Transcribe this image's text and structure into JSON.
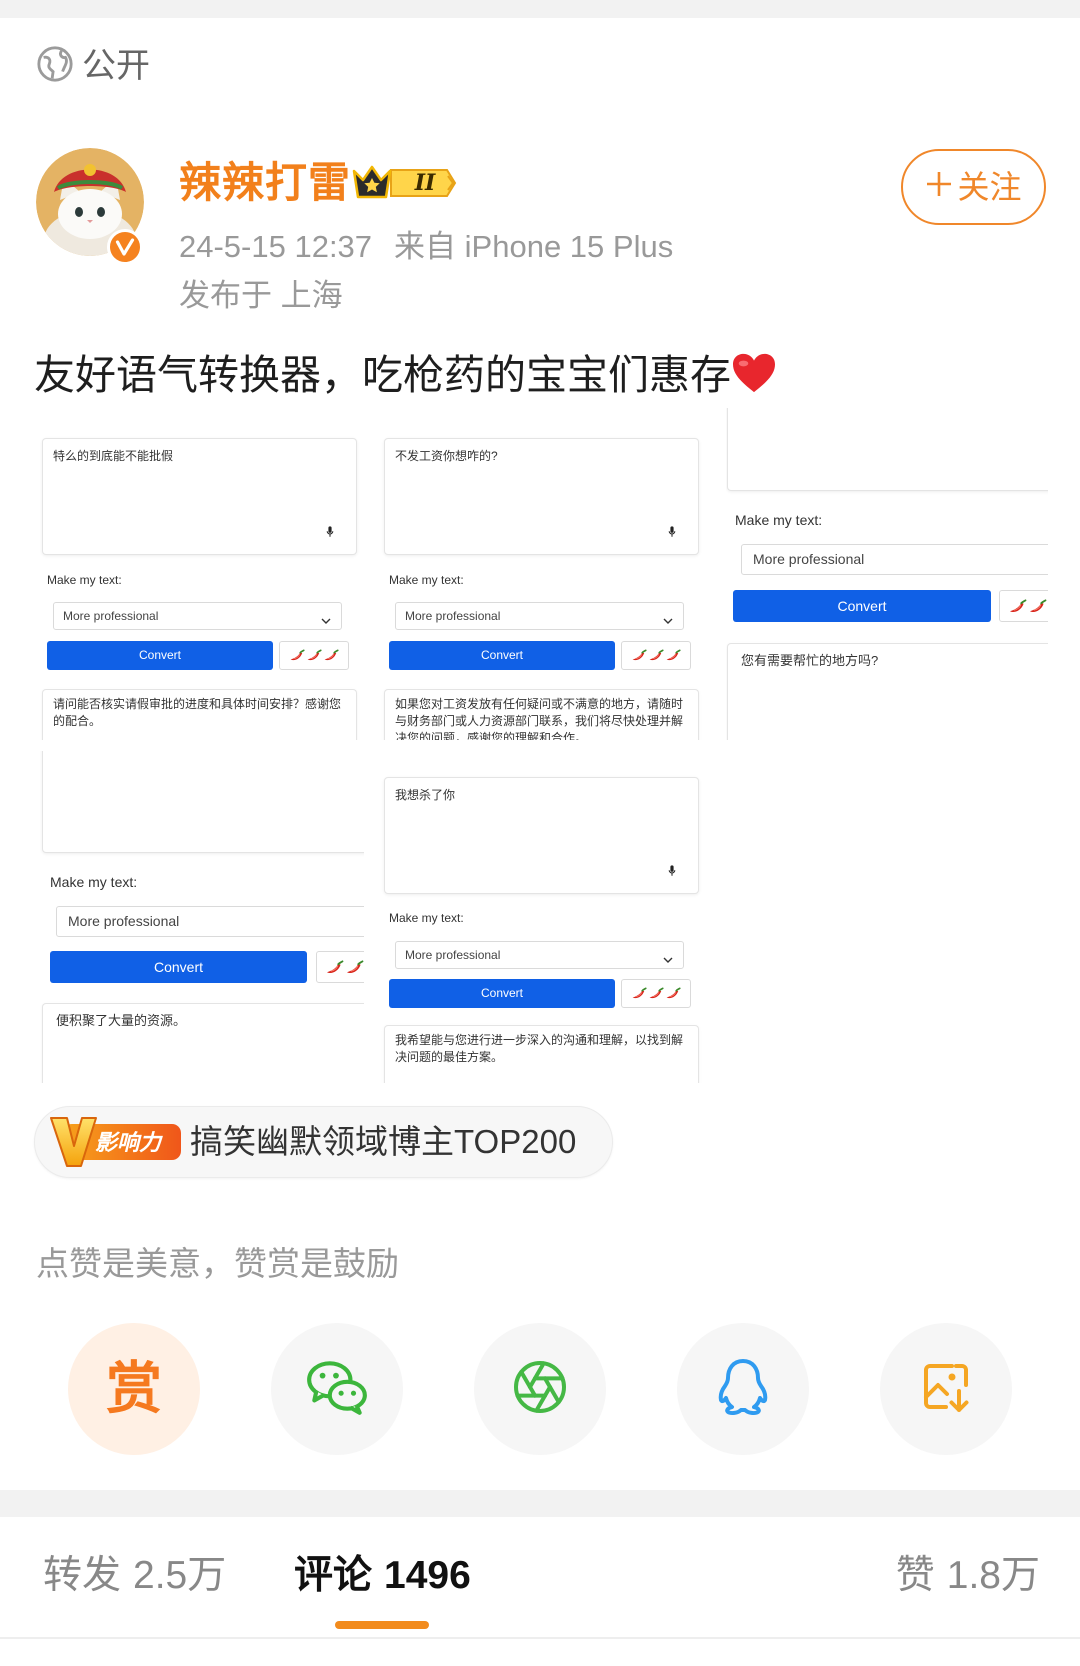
{
  "visibility": {
    "icon": "globe-icon",
    "label": "公开"
  },
  "author": {
    "name": "辣辣打雷",
    "level_badge": "II",
    "avatar": "cat-avatar",
    "verified_icon": "verified-v-icon",
    "timestamp": "24-5-15 12:37",
    "source": "来自 iPhone 15 Plus",
    "location": "发布于 上海",
    "follow_label": "关注",
    "follow_icon": "plus-icon"
  },
  "post": {
    "text": "友好语气转换器，吃枪药的宝宝们惠存",
    "emoji": "red-heart"
  },
  "images": [
    {
      "input_text": "特么的到底能不能批假",
      "label": "Make my text:",
      "tone": "More professional",
      "button": "Convert",
      "chili_count": 3,
      "output_text": "请问能否核实请假审批的进度和具体时间安排？感谢您的配合。"
    },
    {
      "input_text": "不发工资你想咋的?",
      "label": "Make my text:",
      "tone": "More professional",
      "button": "Convert",
      "chili_count": 3,
      "output_text": "如果您对工资发放有任何疑问或不满意的地方，请随时与财务部门或人力资源部门联系，我们将尽快处理并解决您的问题，感谢您的理解和合作。"
    },
    {
      "input_text": "",
      "label": "Make my text:",
      "tone": "More professional",
      "button": "Convert",
      "chili_count": 2,
      "output_text": "您有需要帮忙的地方吗?"
    },
    {
      "input_text": "",
      "label": "Make my text:",
      "tone": "More professional",
      "button": "Convert",
      "chili_count": 2,
      "output_text": "便积聚了大量的资源。"
    },
    {
      "input_text": "我想杀了你",
      "label": "Make my text:",
      "tone": "More professional",
      "button": "Convert",
      "chili_count": 3,
      "output_text": "我希望能与您进行进一步深入的沟通和理解，以找到解决问题的最佳方案。"
    }
  ],
  "influence_badge": {
    "logo_text": "影响力",
    "label": "搞笑幽默领域博主TOP200"
  },
  "reward_prompt": "点赞是美意，赞赏是鼓励",
  "share_actions": [
    {
      "id": "reward",
      "label": "赏"
    },
    {
      "id": "wechat",
      "icon": "wechat-icon"
    },
    {
      "id": "moments",
      "icon": "moments-icon"
    },
    {
      "id": "qq",
      "icon": "qq-icon"
    },
    {
      "id": "save-image",
      "icon": "save-image-icon"
    }
  ],
  "stats": {
    "repost": {
      "label": "转发",
      "count": "2.5万"
    },
    "comments": {
      "label": "评论",
      "count": "1496"
    },
    "likes": {
      "label": "赞",
      "count": "1.8万"
    },
    "active_tab": "comments"
  },
  "colors": {
    "accent": "#f28b1d",
    "username": "#f2801b",
    "verified": "#f5821f",
    "convert_blue": "#1060e6",
    "wechat_green": "#3cb63c",
    "qq_blue": "#2f9bf0",
    "save_orange": "#f5a623"
  }
}
